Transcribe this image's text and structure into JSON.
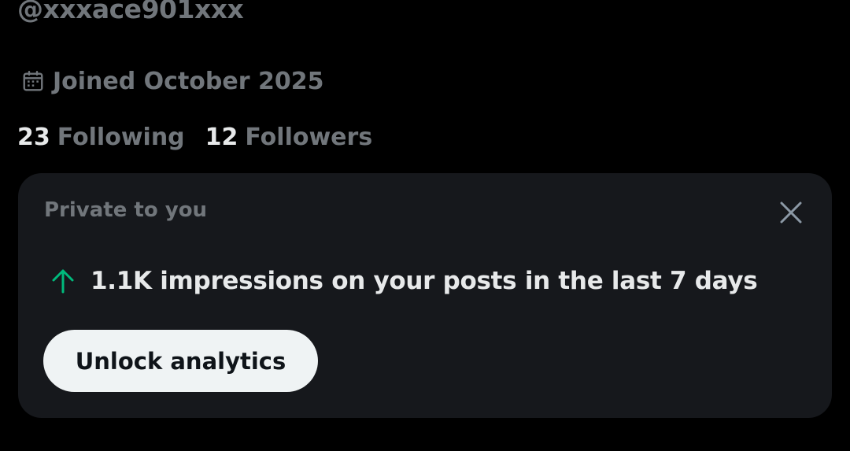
{
  "profile": {
    "handle": "@xxxace901xxx",
    "joined_label": "Joined October 2025",
    "following_count": "23",
    "following_label": "Following",
    "followers_count": "12",
    "followers_label": "Followers"
  },
  "card": {
    "title": "Private to you",
    "metric_text": "1.1K impressions on your posts in the last 7 days",
    "trend_direction": "up",
    "trend_color": "#00ba7c",
    "button_label": "Unlock analytics",
    "close_icon": "close-icon"
  },
  "icons": {
    "joined": "calendar-icon",
    "trend": "arrow-up-icon"
  },
  "colors": {
    "background": "#000000",
    "card_background": "#16181c",
    "primary_text": "#e7e9ea",
    "secondary_text": "#71767b",
    "button_background": "#eff3f4"
  }
}
